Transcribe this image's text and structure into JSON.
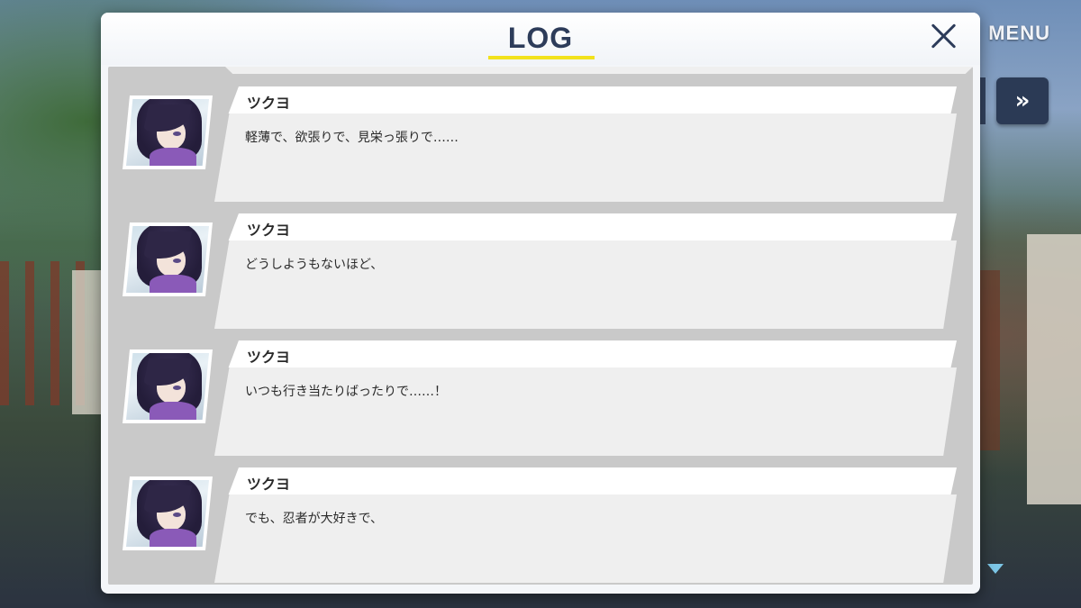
{
  "top_controls": {
    "menu_label": "MENU",
    "skip_label": "»",
    "scroll_indicator_icon": "triangle-down-icon"
  },
  "log": {
    "title": "LOG",
    "close_icon": "close-x-icon",
    "accent_color": "#f2e21c",
    "entries": [
      {
        "speaker": "ツクヨ",
        "text": "軽薄で、欲張りで、見栄っ張りで……"
      },
      {
        "speaker": "ツクヨ",
        "text": "どうしようもないほど、"
      },
      {
        "speaker": "ツクヨ",
        "text": "いつも行き当たりばったりで……！"
      },
      {
        "speaker": "ツクヨ",
        "text": "でも、忍者が大好きで、"
      }
    ]
  }
}
